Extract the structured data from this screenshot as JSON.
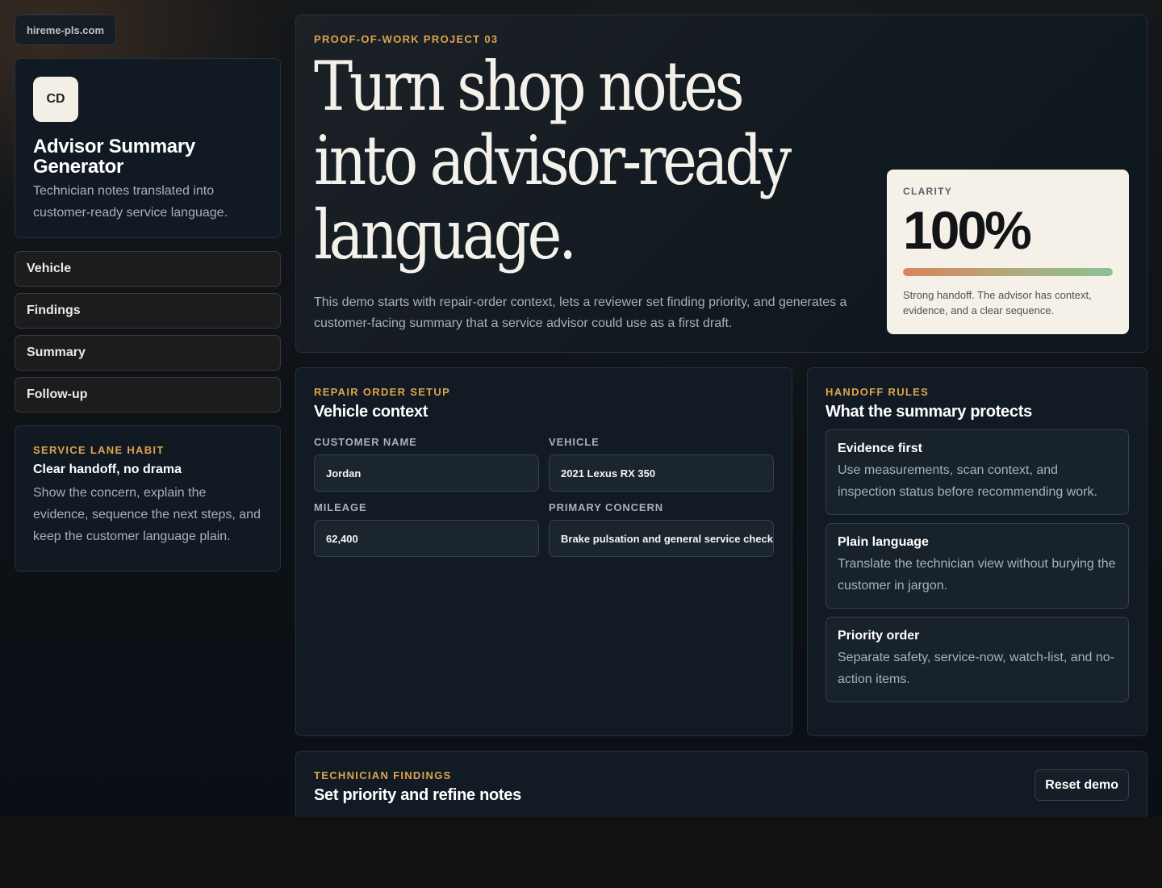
{
  "site": {
    "domain": "hireme-pls.com"
  },
  "brand": {
    "logo_text": "CD",
    "title": "Advisor Summary Generator",
    "subtitle": "Technician notes translated into customer-ready service language."
  },
  "nav": {
    "items": [
      {
        "label": "Vehicle"
      },
      {
        "label": "Findings"
      },
      {
        "label": "Summary"
      },
      {
        "label": "Follow-up"
      }
    ]
  },
  "habit": {
    "eyebrow": "SERVICE LANE HABIT",
    "title": "Clear handoff, no drama",
    "body": "Show the concern, explain the evidence, sequence the next steps, and keep the customer language plain."
  },
  "hero": {
    "eyebrow": "PROOF-OF-WORK PROJECT 03",
    "title": "Turn shop notes into advisor-ready language.",
    "description": "This demo starts with repair-order context, lets a reviewer set finding priority, and generates a customer-facing summary that a service advisor could use as a first draft."
  },
  "clarity": {
    "label": "CLARITY",
    "value": "100%",
    "progress": 1.0,
    "note": "Strong handoff. The advisor has context, evidence, and a clear sequence."
  },
  "setup": {
    "eyebrow": "REPAIR ORDER SETUP",
    "title": "Vehicle context",
    "fields": [
      {
        "label": "CUSTOMER NAME",
        "value": "Jordan"
      },
      {
        "label": "VEHICLE",
        "value": "2021 Lexus RX 350"
      },
      {
        "label": "MILEAGE",
        "value": "62,400"
      },
      {
        "label": "PRIMARY CONCERN",
        "value": "Brake pulsation and general service check"
      }
    ]
  },
  "rules": {
    "eyebrow": "HANDOFF RULES",
    "title": "What the summary protects",
    "items": [
      {
        "title": "Evidence first",
        "body": "Use measurements, scan context, and inspection status before recommending work."
      },
      {
        "title": "Plain language",
        "body": "Translate the technician view without burying the customer in jargon."
      },
      {
        "title": "Priority order",
        "body": "Separate safety, service-now, watch-list, and no-action items."
      }
    ]
  },
  "findings": {
    "eyebrow": "TECHNICIAN FINDINGS",
    "title": "Set priority and refine notes",
    "reset_label": "Reset demo"
  },
  "colors": {
    "accent": "#e0a34d",
    "background": "#0d1217",
    "card": "#111a22",
    "score_card": "#f5f1e8"
  }
}
